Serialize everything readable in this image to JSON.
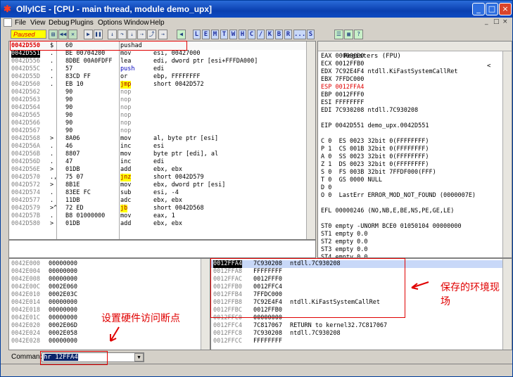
{
  "window": {
    "title": "OllyICE - [CPU - main thread, module demo_upx]",
    "app_icon": "ollydbg-bug-icon",
    "controls": [
      "_",
      "□",
      "×"
    ]
  },
  "menu": {
    "items": [
      "File",
      "View",
      "Debug",
      "Plugins",
      "Options",
      "Window",
      "Help"
    ],
    "mdi_controls": [
      "_",
      "□",
      "×"
    ]
  },
  "toolbar": {
    "status": "Paused",
    "letters": [
      "L",
      "E",
      "M",
      "T",
      "W",
      "H",
      "C",
      "/",
      "K",
      "B",
      "R",
      "...",
      "S"
    ]
  },
  "disasm": {
    "rows": [
      {
        "addr": "0042D550",
        "mark": "$",
        "hex": "60",
        "mn": "pushad",
        "ops": "",
        "style": "first"
      },
      {
        "addr": "0042D551",
        "mark": ".",
        "hex": "BE 00704200",
        "mn": "mov",
        "ops": "esi, 00427000",
        "style": "sel"
      },
      {
        "addr": "0042D556",
        "mark": ".",
        "hex": "8DBE 00A0FDFF",
        "mn": "lea",
        "ops": "edi, dword ptr [esi+FFFDA000]",
        "style": ""
      },
      {
        "addr": "0042D55C",
        "mark": ".",
        "hex": "57",
        "mn": "push",
        "ops": "edi",
        "style": "blue"
      },
      {
        "addr": "0042D55D",
        "mark": ".",
        "hex": "83CD FF",
        "mn": "or",
        "ops": "ebp, FFFFFFFF",
        "style": ""
      },
      {
        "addr": "0042D560",
        "mark": ".",
        "hex": "EB 10",
        "mn": "jmp",
        "ops": "short 0042D572",
        "style": "jmp"
      },
      {
        "addr": "0042D562",
        "mark": "",
        "hex": "90",
        "mn": "nop",
        "ops": "",
        "style": "nop"
      },
      {
        "addr": "0042D563",
        "mark": "",
        "hex": "90",
        "mn": "nop",
        "ops": "",
        "style": "nop"
      },
      {
        "addr": "0042D564",
        "mark": "",
        "hex": "90",
        "mn": "nop",
        "ops": "",
        "style": "nop"
      },
      {
        "addr": "0042D565",
        "mark": "",
        "hex": "90",
        "mn": "nop",
        "ops": "",
        "style": "nop"
      },
      {
        "addr": "0042D566",
        "mark": "",
        "hex": "90",
        "mn": "nop",
        "ops": "",
        "style": "nop"
      },
      {
        "addr": "0042D567",
        "mark": "",
        "hex": "90",
        "mn": "nop",
        "ops": "",
        "style": "nop"
      },
      {
        "addr": "0042D568",
        "mark": ">",
        "hex": "8A06",
        "mn": "mov",
        "ops": "al, byte ptr [esi]",
        "style": ""
      },
      {
        "addr": "0042D56A",
        "mark": ".",
        "hex": "46",
        "mn": "inc",
        "ops": "esi",
        "style": ""
      },
      {
        "addr": "0042D56B",
        "mark": ".",
        "hex": "8807",
        "mn": "mov",
        "ops": "byte ptr [edi], al",
        "style": ""
      },
      {
        "addr": "0042D56D",
        "mark": ".",
        "hex": "47",
        "mn": "inc",
        "ops": "edi",
        "style": ""
      },
      {
        "addr": "0042D56E",
        "mark": ">",
        "hex": "01DB",
        "mn": "add",
        "ops": "ebx, ebx",
        "style": ""
      },
      {
        "addr": "0042D570",
        "mark": ".,",
        "hex": "75 07",
        "mn": "jnz",
        "ops": "short 0042D579",
        "style": "jmp"
      },
      {
        "addr": "0042D572",
        "mark": ">",
        "hex": "8B1E",
        "mn": "mov",
        "ops": "ebx, dword ptr [esi]",
        "style": ""
      },
      {
        "addr": "0042D574",
        "mark": ".",
        "hex": "83EE FC",
        "mn": "sub",
        "ops": "esi, -4",
        "style": ""
      },
      {
        "addr": "0042D577",
        "mark": ".",
        "hex": "11DB",
        "mn": "adc",
        "ops": "ebx, ebx",
        "style": ""
      },
      {
        "addr": "0042D579",
        "mark": ">^",
        "hex": "72 ED",
        "mn": "jb",
        "ops": "short 0042D568",
        "style": "jmp"
      },
      {
        "addr": "0042D57B",
        "mark": ".",
        "hex": "B8 01000000",
        "mn": "mov",
        "ops": "eax, 1",
        "style": ""
      },
      {
        "addr": "0042D580",
        "mark": ">",
        "hex": "01DB",
        "mn": "add",
        "ops": "ebx, ebx",
        "style": ""
      }
    ]
  },
  "registers": {
    "header": "Registers (FPU)",
    "lines": [
      {
        "t": "EAX 00000000",
        "c": ""
      },
      {
        "t": "ECX 0012FFB0",
        "c": ""
      },
      {
        "t": "EDX 7C92E4F4 ntdll.KiFastSystemCallRet",
        "c": ""
      },
      {
        "t": "EBX 7FFDC000",
        "c": ""
      },
      {
        "t": "ESP 0012FFA4",
        "c": "red"
      },
      {
        "t": "EBP 0012FFF0",
        "c": ""
      },
      {
        "t": "ESI FFFFFFFF",
        "c": ""
      },
      {
        "t": "EDI 7C930208 ntdll.7C930208",
        "c": ""
      },
      {
        "t": "",
        "c": ""
      },
      {
        "t": "EIP 0042D551 demo_upx.0042D551",
        "c": "eip"
      },
      {
        "t": "",
        "c": ""
      },
      {
        "t": "C 0  ES 0023 32bit 0(FFFFFFFF)",
        "c": ""
      },
      {
        "t": "P 1  CS 001B 32bit 0(FFFFFFFF)",
        "c": ""
      },
      {
        "t": "A 0  SS 0023 32bit 0(FFFFFFFF)",
        "c": ""
      },
      {
        "t": "Z 1  DS 0023 32bit 0(FFFFFFFF)",
        "c": ""
      },
      {
        "t": "S 0  FS 003B 32bit 7FFDF000(FFF)",
        "c": ""
      },
      {
        "t": "T 0  GS 0000 NULL",
        "c": ""
      },
      {
        "t": "D 0",
        "c": ""
      },
      {
        "t": "O 0  LastErr ERROR_MOD_NOT_FOUND (0000007E)",
        "c": ""
      },
      {
        "t": "",
        "c": ""
      },
      {
        "t": "EFL 00000246 (NO,NB,E,BE,NS,PE,GE,LE)",
        "c": ""
      },
      {
        "t": "",
        "c": ""
      },
      {
        "t": "ST0 empty -UNORM BCE0 01050104 00000000",
        "c": ""
      },
      {
        "t": "ST1 empty 0.0",
        "c": ""
      },
      {
        "t": "ST2 empty 0.0",
        "c": ""
      },
      {
        "t": "ST3 empty 0.0",
        "c": ""
      },
      {
        "t": "ST4 empty 0.0",
        "c": ""
      }
    ]
  },
  "dump": {
    "rows": [
      [
        "0042E000",
        "00000000"
      ],
      [
        "0042E004",
        "00000000"
      ],
      [
        "0042E008",
        "00000000"
      ],
      [
        "0042E00C",
        "0002E060"
      ],
      [
        "0042E010",
        "0002E03C"
      ],
      [
        "0042E014",
        "00000000"
      ],
      [
        "0042E018",
        "00000000"
      ],
      [
        "0042E01C",
        "00000000"
      ],
      [
        "0042E020",
        "0002E06D"
      ],
      [
        "0042E024",
        "0002E058"
      ],
      [
        "0042E028",
        "00000000"
      ]
    ]
  },
  "stack": {
    "rows": [
      [
        "0012FFA4",
        "7C930208",
        "ntdll.7C930208"
      ],
      [
        "0012FFA8",
        "FFFFFFFF",
        ""
      ],
      [
        "0012FFAC",
        "0012FFF0",
        ""
      ],
      [
        "0012FFB0",
        "0012FFC4",
        ""
      ],
      [
        "0012FFB4",
        "7FFDC000",
        ""
      ],
      [
        "0012FFB8",
        "7C92E4F4",
        "ntdll.KiFastSystemCallRet"
      ],
      [
        "0012FFBC",
        "0012FFB0",
        ""
      ],
      [
        "0012FFC0",
        "00000000",
        ""
      ],
      [
        "0012FFC4",
        "7C817067",
        "RETURN to kernel32.7C817067"
      ],
      [
        "0012FFC8",
        "7C930208",
        "ntdll.7C930208"
      ],
      [
        "0012FFCC",
        "FFFFFFFF",
        ""
      ]
    ]
  },
  "annotations": {
    "saved_env": "保存的环境现场",
    "hw_breakpoint": "设置硬件访问断点"
  },
  "command": {
    "label": "Command",
    "value": "hr 12FFA4"
  }
}
